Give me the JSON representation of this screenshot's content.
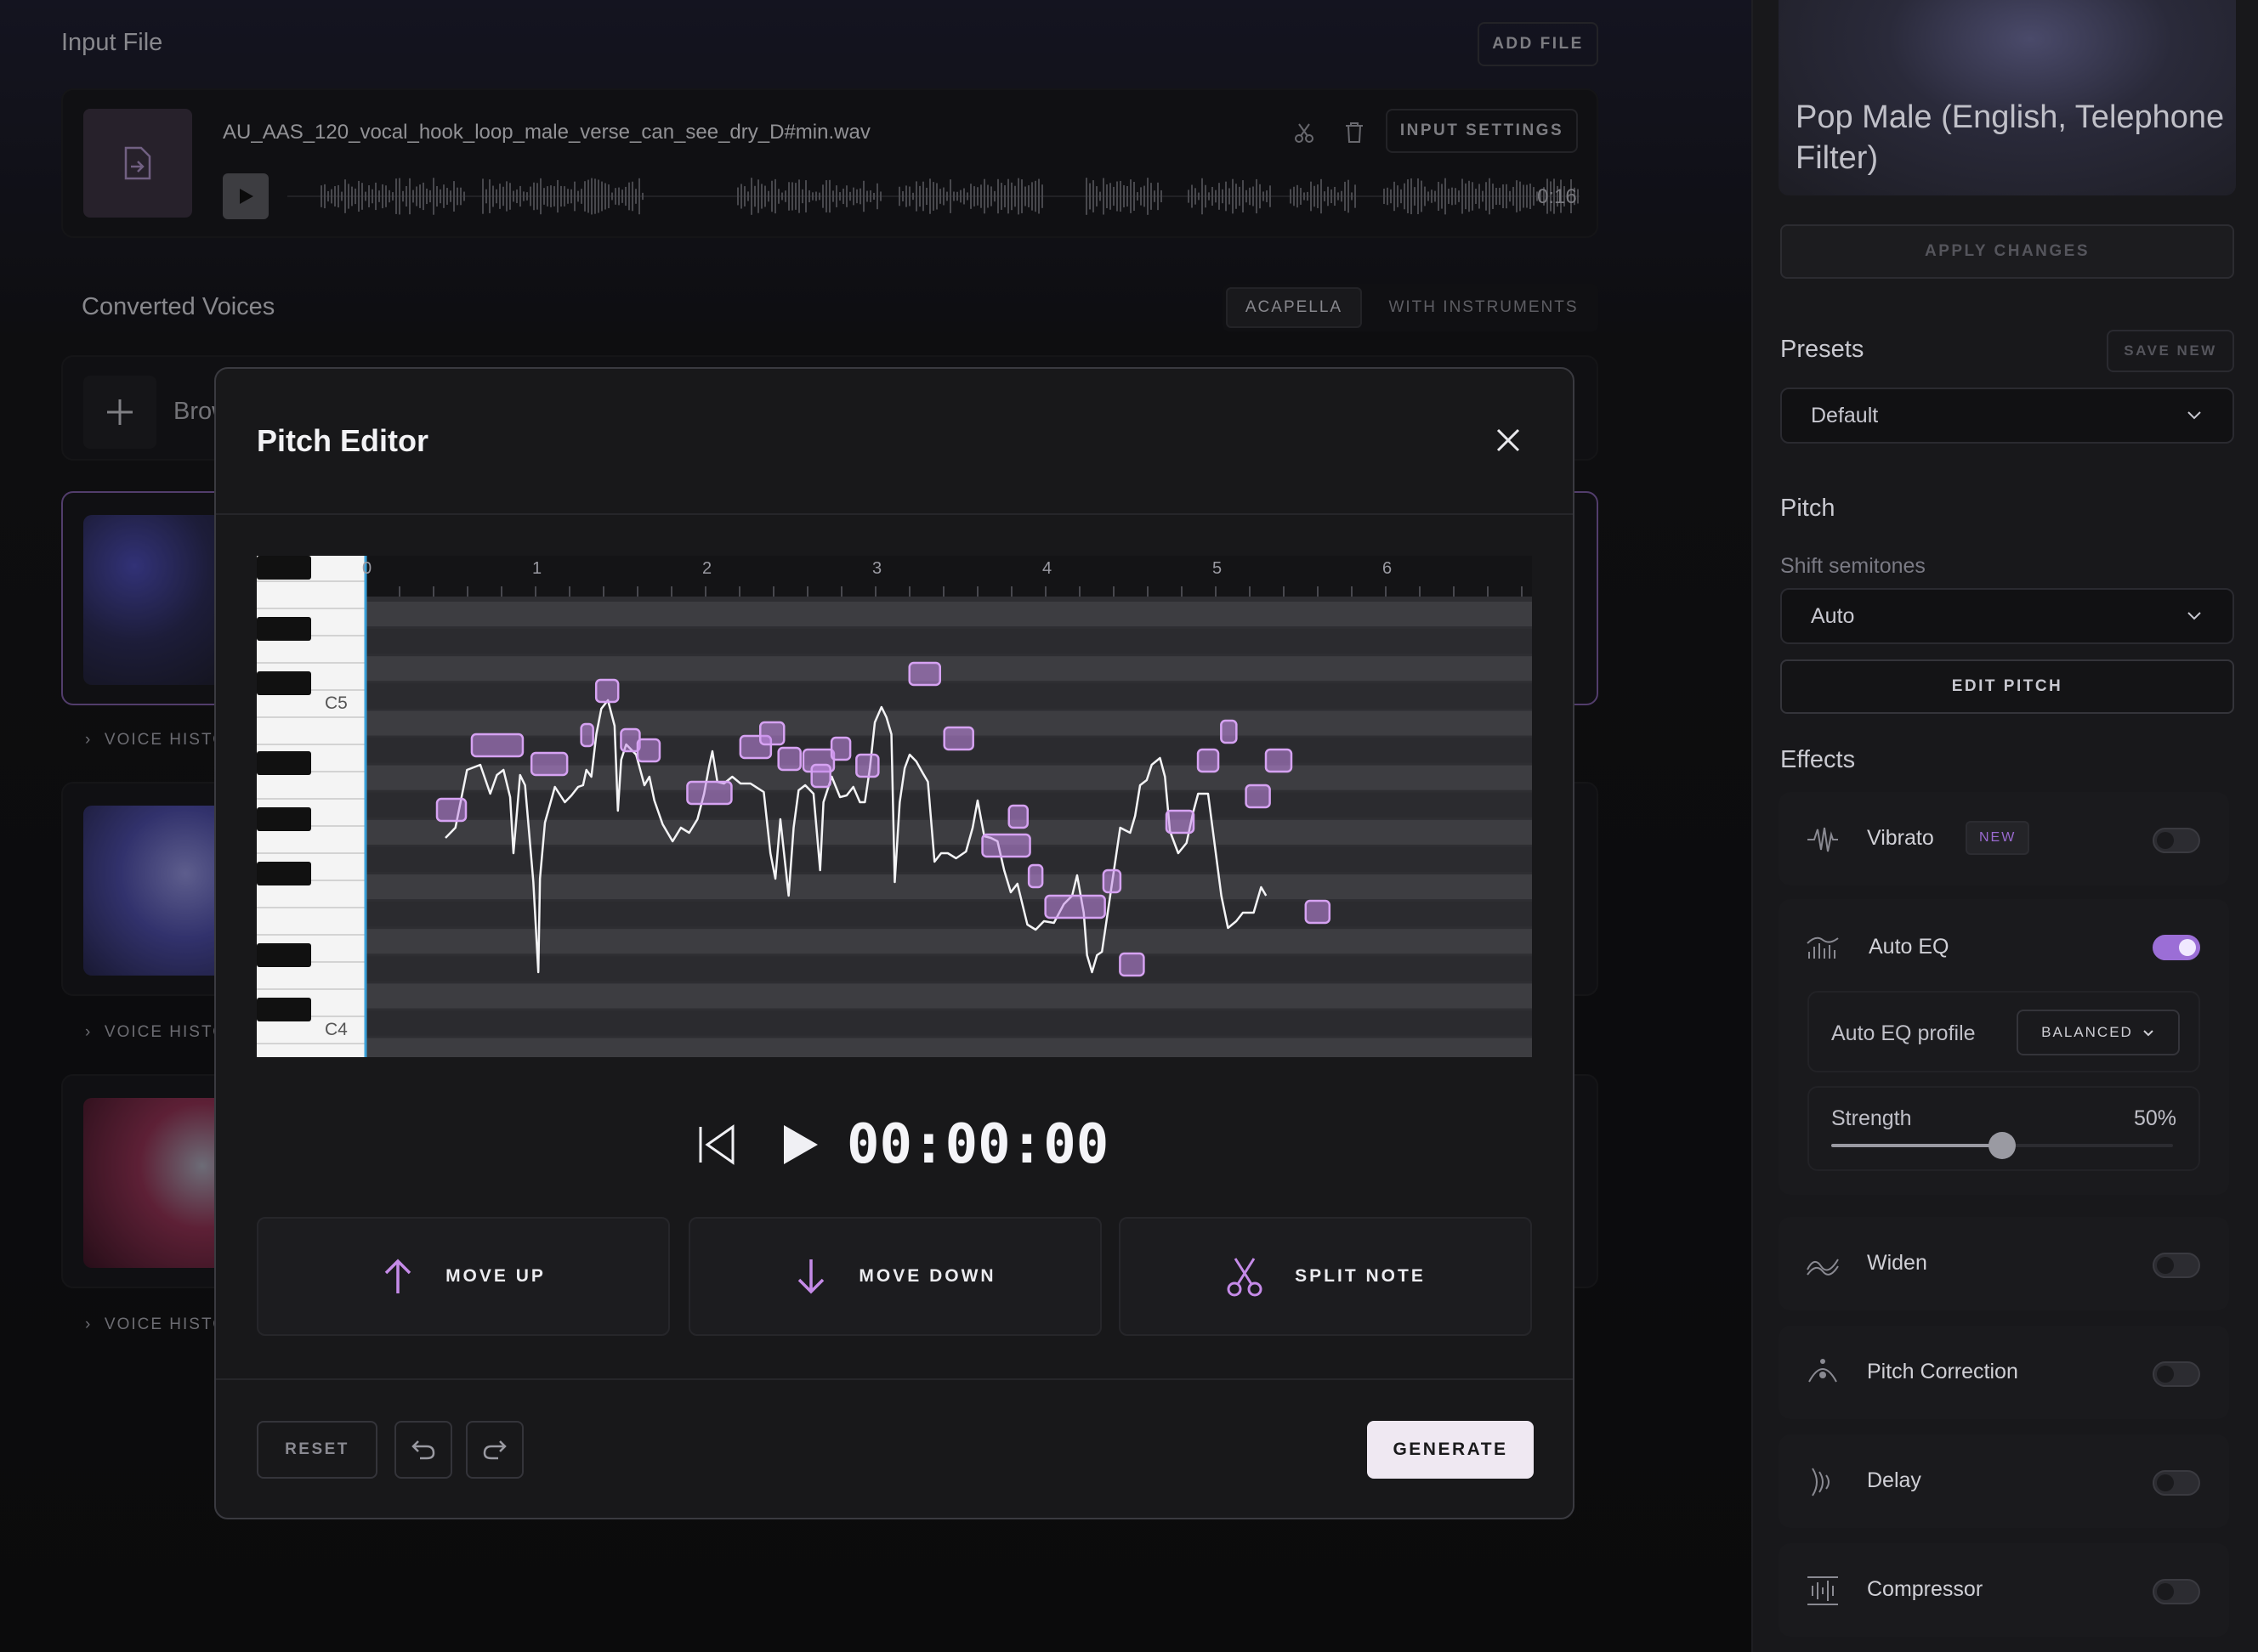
{
  "input_file": {
    "title": "Input File",
    "add_file_label": "ADD FILE",
    "filename": "AU_AAS_120_vocal_hook_loop_male_verse_can_see_dry_D#min.wav",
    "duration": "0:16",
    "input_settings_label": "INPUT SETTINGS"
  },
  "converted": {
    "title": "Converted Voices",
    "tabs": [
      {
        "label": "ACAPELLA",
        "active": true
      },
      {
        "label": "WITH INSTRUMENTS",
        "active": false
      }
    ],
    "browse_label": "Brow",
    "voice_history_label": "VOICE HISTO"
  },
  "right_panel": {
    "voice_name": "Pop Male (English, Telephone Filter)",
    "apply_label": "APPLY CHANGES",
    "presets_title": "Presets",
    "save_new_label": "SAVE NEW",
    "preset_value": "Default",
    "pitch_title": "Pitch",
    "shift_label": "Shift semitones",
    "shift_value": "Auto",
    "edit_pitch_label": "EDIT PITCH",
    "effects_title": "Effects",
    "effects": [
      {
        "name": "Vibrato",
        "badge": "NEW",
        "on": false,
        "icon": "vibrato-icon"
      },
      {
        "name": "Auto EQ",
        "on": true,
        "icon": "eq-icon"
      },
      {
        "name": "Widen",
        "on": false,
        "icon": "widen-icon"
      },
      {
        "name": "Pitch Correction",
        "on": false,
        "icon": "pitch-correction-icon"
      },
      {
        "name": "Delay",
        "on": false,
        "icon": "delay-icon"
      },
      {
        "name": "Compressor",
        "on": false,
        "icon": "compressor-icon"
      }
    ],
    "auto_eq_profile_label": "Auto EQ profile",
    "auto_eq_profile_value": "BALANCED",
    "strength_label": "Strength",
    "strength_value": "50%",
    "strength_fraction": 0.5
  },
  "modal": {
    "title": "Pitch Editor",
    "ruler_labels": [
      "0",
      "1",
      "2",
      "3",
      "4",
      "5",
      "6"
    ],
    "note_labels": [
      "C5",
      "C4"
    ],
    "timecode": "00:00:00",
    "move_up_label": "MOVE UP",
    "move_down_label": "MOVE DOWN",
    "split_note_label": "SPLIT NOTE",
    "reset_label": "RESET",
    "generate_label": "GENERATE"
  },
  "colors": {
    "accent": "#c58be8",
    "toggle_on": "#9b6ed6",
    "generate_bg": "#efe8f2"
  }
}
